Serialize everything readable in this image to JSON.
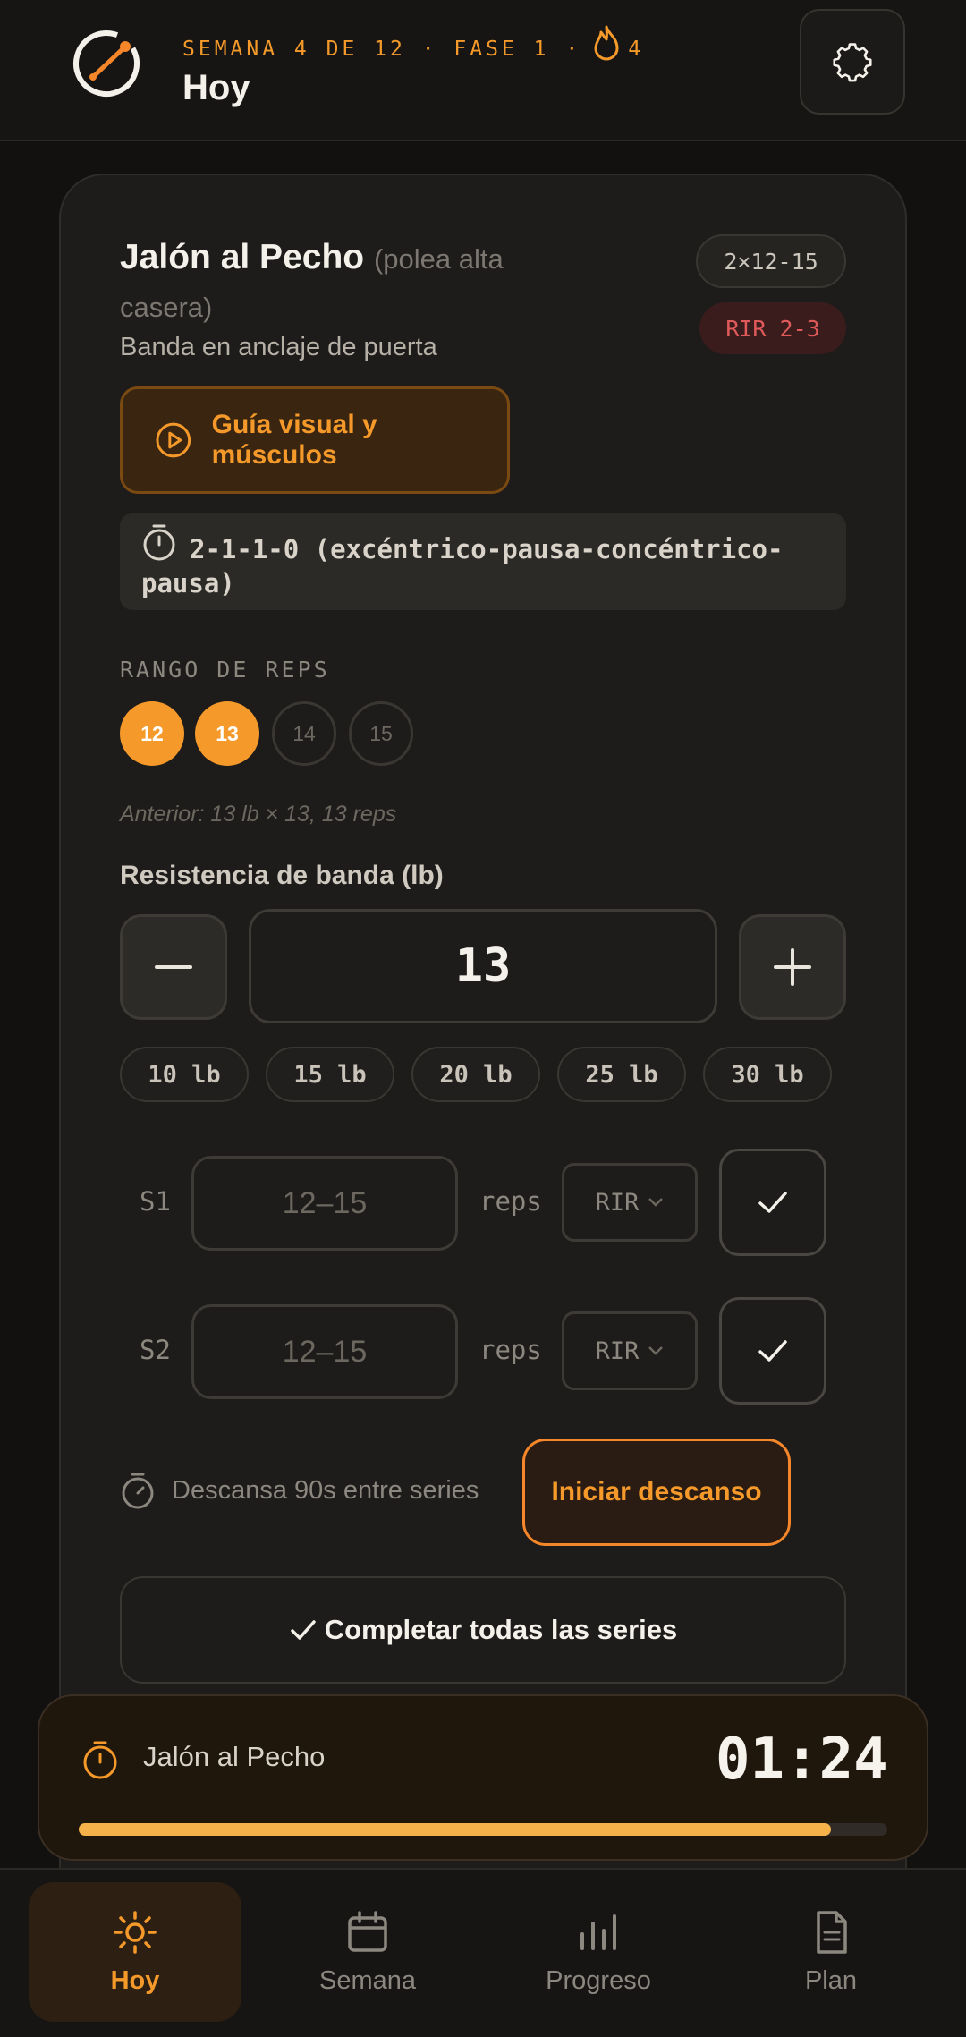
{
  "header": {
    "week_label": "SEMANA 4 DE 12 · FASE 1 ·",
    "streak_count": "4",
    "title": "Hoy"
  },
  "exercise": {
    "name": "Jalón al Pecho",
    "variant": "(polea alta casera)",
    "equipment": "Banda en anclaje de puerta",
    "sets_badge": "2×12-15",
    "rir_badge": "RIR 2-3",
    "guide_label": "Guía visual y músculos",
    "tempo": "2-1-1-0 (excéntrico-pausa-concéntrico-pausa)",
    "reps_range_label": "RANGO DE REPS",
    "reps_options": [
      {
        "value": "12",
        "selected": true
      },
      {
        "value": "13",
        "selected": true
      },
      {
        "value": "14",
        "selected": false
      },
      {
        "value": "15",
        "selected": false
      }
    ],
    "previous": "Anterior: 13 lb × 13, 13 reps",
    "resistance_label": "Resistencia de banda (lb)",
    "resistance_value": "13",
    "presets": [
      "10 lb",
      "15 lb",
      "20 lb",
      "25 lb",
      "30 lb"
    ],
    "sets": [
      {
        "label": "S1",
        "placeholder": "12–15",
        "unit": "reps",
        "rir": "RIR"
      },
      {
        "label": "S2",
        "placeholder": "12–15",
        "unit": "reps",
        "rir": "RIR"
      }
    ],
    "rest_hint": "Descansa 90s entre series",
    "rest_button": "Iniciar descanso",
    "complete_button": "Completar todas las series"
  },
  "rest_timer": {
    "exercise": "Jalón al Pecho",
    "time": "01:24",
    "progress": 0.93
  },
  "nav": {
    "items": [
      {
        "label": "Hoy",
        "icon": "sun-icon",
        "active": true
      },
      {
        "label": "Semana",
        "icon": "calendar-icon",
        "active": false
      },
      {
        "label": "Progreso",
        "icon": "bar-chart-icon",
        "active": false
      },
      {
        "label": "Plan",
        "icon": "document-icon",
        "active": false
      }
    ]
  },
  "colors": {
    "accent": "#f59a2a",
    "background": "#121110",
    "card": "#1d1c1a",
    "danger": "#e05a5a"
  }
}
